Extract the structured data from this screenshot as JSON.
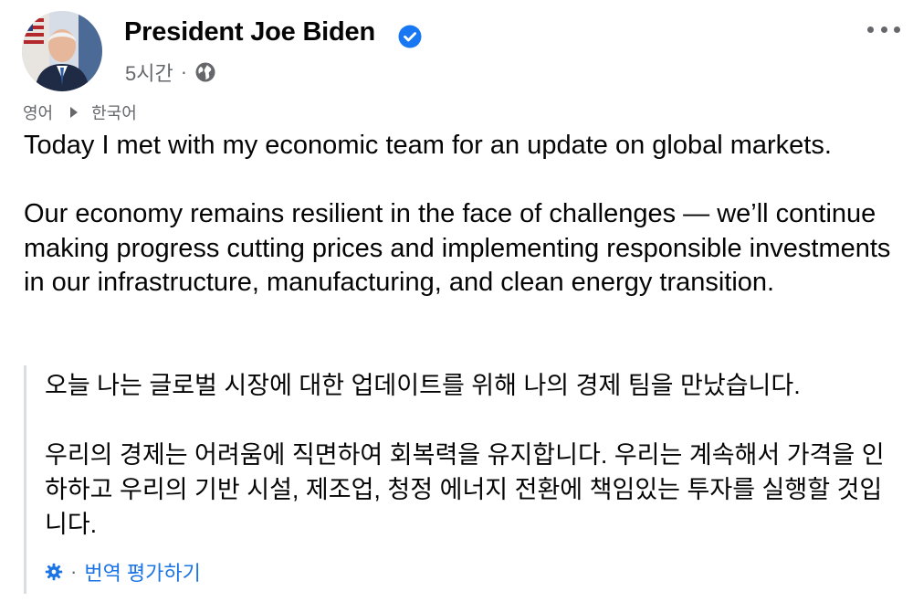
{
  "post": {
    "author": "President Joe Biden",
    "time": "5시간",
    "separator": "·",
    "visibility_icon": "globe-icon",
    "verified_icon": "verified-badge-icon",
    "more_icon": "more-options-icon"
  },
  "translation_bar": {
    "source_lang": "영어",
    "target_lang": "한국어",
    "arrow_icon": "play-arrow-icon"
  },
  "body": {
    "paragraphs": [
      "Today I met with my economic team for an update on global markets.",
      "Our economy remains resilient in the face of challenges — we’ll continue making progress cutting prices and implementing responsible investments in our infrastructure, manufacturing, and clean energy transition."
    ]
  },
  "translation": {
    "paragraphs": [
      "오늘 나는 글로벌 시장에 대한 업데이트를 위해 나의 경제 팀을 만났습니다.",
      "우리의 경제는 어려움에 직면하여 회복력을 유지합니다. 우리는 계속해서 가격을 인하하고 우리의 기반 시설, 제조업, 청정 에너지 전환에 책임있는 투자를 실행할 것입니다."
    ],
    "rate_separator": "·",
    "rate_label": "번역 평가하기",
    "settings_icon": "gear-icon"
  },
  "colors": {
    "text": "#050505",
    "secondary": "#65676b",
    "link": "#1b74e4",
    "verified": "#1877f2",
    "divider": "#dadde1"
  }
}
